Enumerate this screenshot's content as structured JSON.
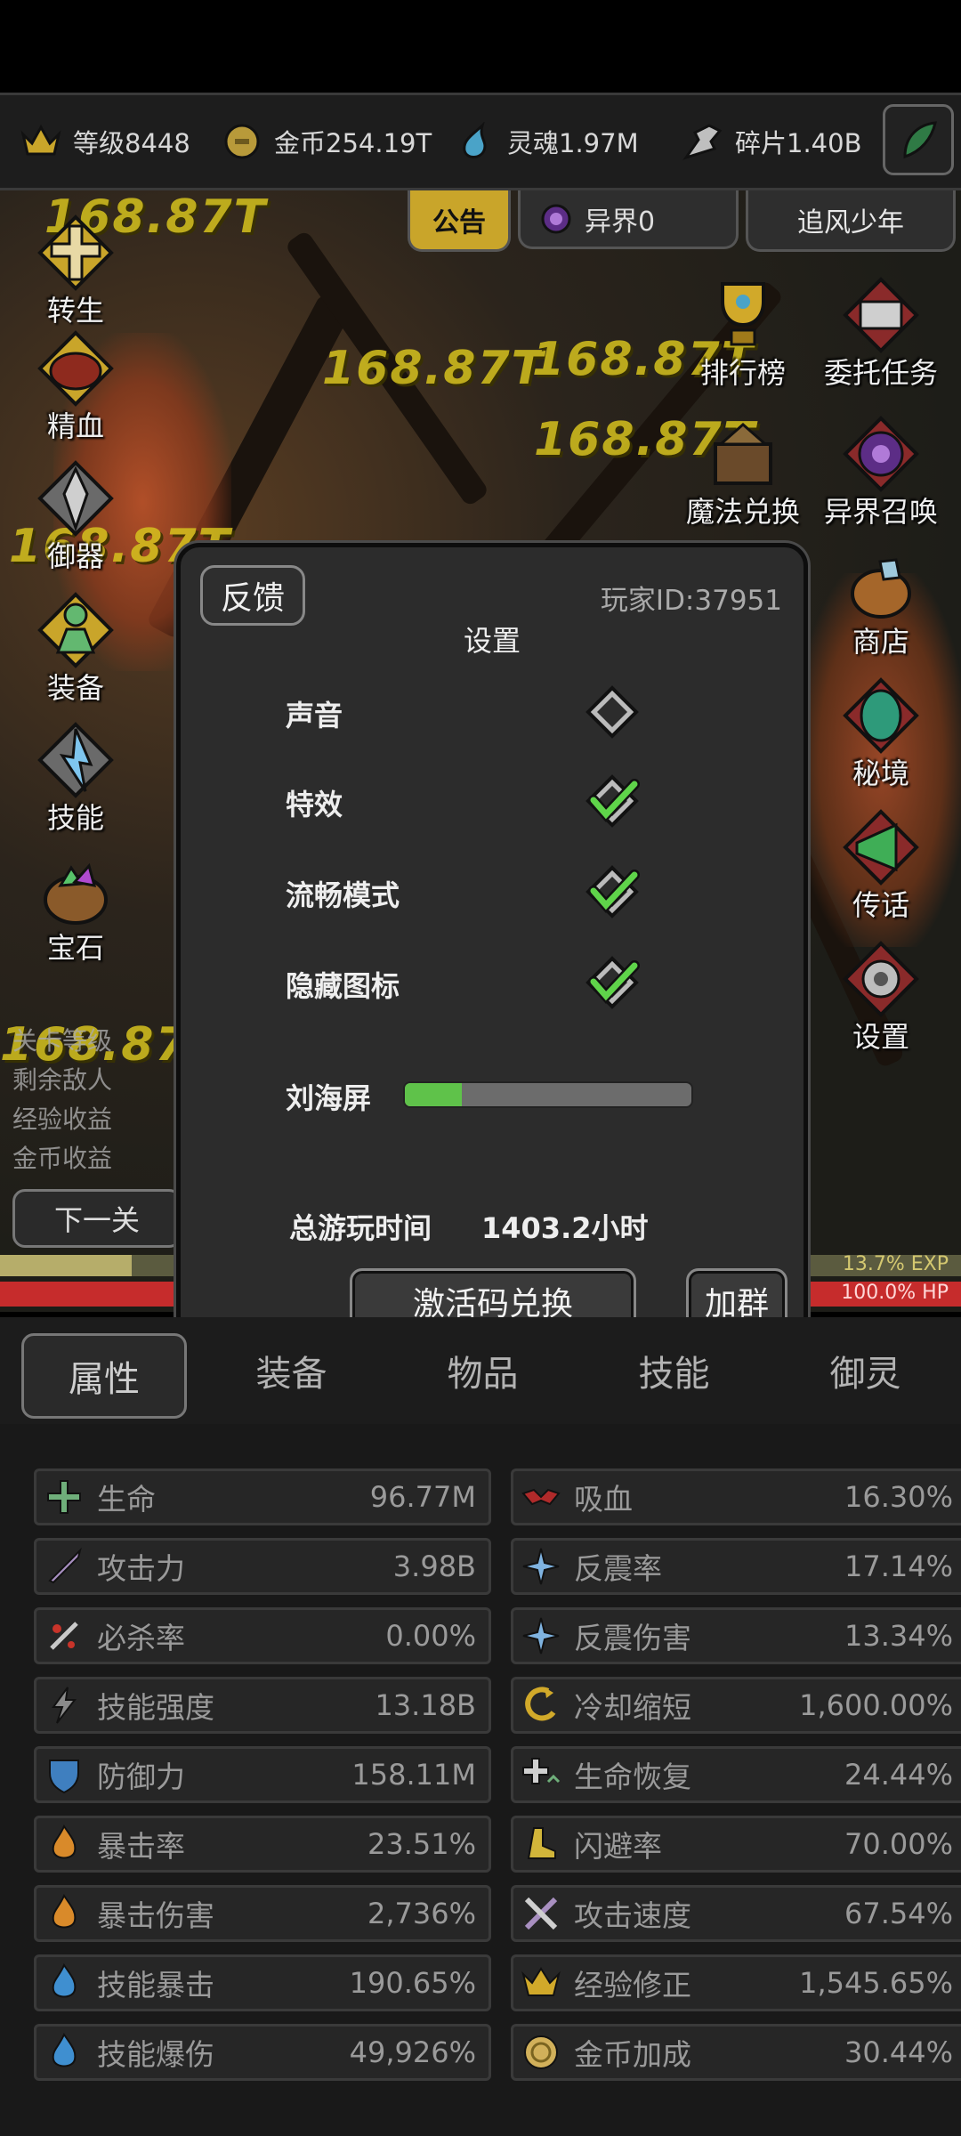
{
  "resources": [
    {
      "icon": "crown-icon",
      "label": "等级8448"
    },
    {
      "icon": "coin-icon",
      "label": "金币254.19T"
    },
    {
      "icon": "soul-icon",
      "label": "灵魂1.97M"
    },
    {
      "icon": "shard-icon",
      "label": "碎片1.40B"
    }
  ],
  "ribbons": {
    "notice": "公告",
    "otherworld": "异界0",
    "player_name": "追风少年"
  },
  "damage_numbers": [
    "168.87T",
    "168.87T",
    "168.87T",
    "168.87T",
    "168.87T",
    "168.87T"
  ],
  "left_menu": [
    {
      "icon": "rebirth-icon",
      "label": "转生"
    },
    {
      "icon": "essence-icon",
      "label": "精血"
    },
    {
      "icon": "armor-icon",
      "label": "御器"
    },
    {
      "icon": "equip-icon",
      "label": "装备"
    },
    {
      "icon": "skill-icon",
      "label": "技能"
    },
    {
      "icon": "gem-icon",
      "label": "宝石"
    }
  ],
  "right_menu": [
    {
      "icon": "trophy-icon",
      "label": "排行榜"
    },
    {
      "icon": "quest-icon",
      "label": "委托任务"
    },
    {
      "icon": "magic-exchange-icon",
      "label": "魔法兑换"
    },
    {
      "icon": "summon-icon",
      "label": "异界召唤"
    },
    {
      "icon": "shop-icon",
      "label": "商店"
    },
    {
      "icon": "secret-realm-icon",
      "label": "秘境"
    },
    {
      "icon": "megaphone-icon",
      "label": "传话"
    },
    {
      "icon": "settings-icon",
      "label": "设置"
    }
  ],
  "left_stats": [
    "关卡等级",
    "剩余敌人",
    "经验收益",
    "金币收益"
  ],
  "next_level": "下一关",
  "bars": {
    "exp_text": "13.7% EXP",
    "exp_fraction": 0.137,
    "hp_text": "100.0%  HP",
    "hp_fraction": 1.0
  },
  "modal": {
    "feedback": "反馈",
    "player_id": "玩家ID:37951",
    "title": "设置",
    "options": [
      {
        "label": "声音",
        "checked": false
      },
      {
        "label": "特效",
        "checked": true
      },
      {
        "label": "流畅模式",
        "checked": true
      },
      {
        "label": "隐藏图标",
        "checked": true
      }
    ],
    "notch_label": "刘海屏",
    "notch_fraction": 0.2,
    "playtime_label": "总游玩时间",
    "playtime_value": "1403.2小时",
    "redeem_button": "激活码兑换",
    "group_button": "加群"
  },
  "tabs": [
    "属性",
    "装备",
    "物品",
    "技能",
    "御灵"
  ],
  "stats_left": [
    {
      "icon": "plus-cross-icon",
      "name": "生命",
      "value": "96.77M"
    },
    {
      "icon": "sword-icon",
      "name": "攻击力",
      "value": "3.98B"
    },
    {
      "icon": "crit-kill-icon",
      "name": "必杀率",
      "value": "0.00%"
    },
    {
      "icon": "lightning-icon",
      "name": "技能强度",
      "value": "13.18B"
    },
    {
      "icon": "shield-icon",
      "name": "防御力",
      "value": "158.11M"
    },
    {
      "icon": "flame-icon",
      "name": "暴击率",
      "value": "23.51%"
    },
    {
      "icon": "flame-icon",
      "name": "暴击伤害",
      "value": "2,736%"
    },
    {
      "icon": "blue-flame-icon",
      "name": "技能暴击",
      "value": "190.65%"
    },
    {
      "icon": "blue-flame-icon",
      "name": "技能爆伤",
      "value": "49,926%"
    }
  ],
  "stats_right": [
    {
      "icon": "bat-icon",
      "name": "吸血",
      "value": "16.30%"
    },
    {
      "icon": "spark-icon",
      "name": "反震率",
      "value": "17.14%"
    },
    {
      "icon": "spark-icon",
      "name": "反震伤害",
      "value": "13.34%"
    },
    {
      "icon": "cooldown-icon",
      "name": "冷却缩短",
      "value": "1,600.00%"
    },
    {
      "icon": "regen-icon",
      "name": "生命恢复",
      "value": "24.44%"
    },
    {
      "icon": "boot-icon",
      "name": "闪避率",
      "value": "70.00%"
    },
    {
      "icon": "swords-icon",
      "name": "攻击速度",
      "value": "67.54%"
    },
    {
      "icon": "crown-icon",
      "name": "经验修正",
      "value": "1,545.65%"
    },
    {
      "icon": "coin-icon",
      "name": "金币加成",
      "value": "30.44%"
    }
  ]
}
